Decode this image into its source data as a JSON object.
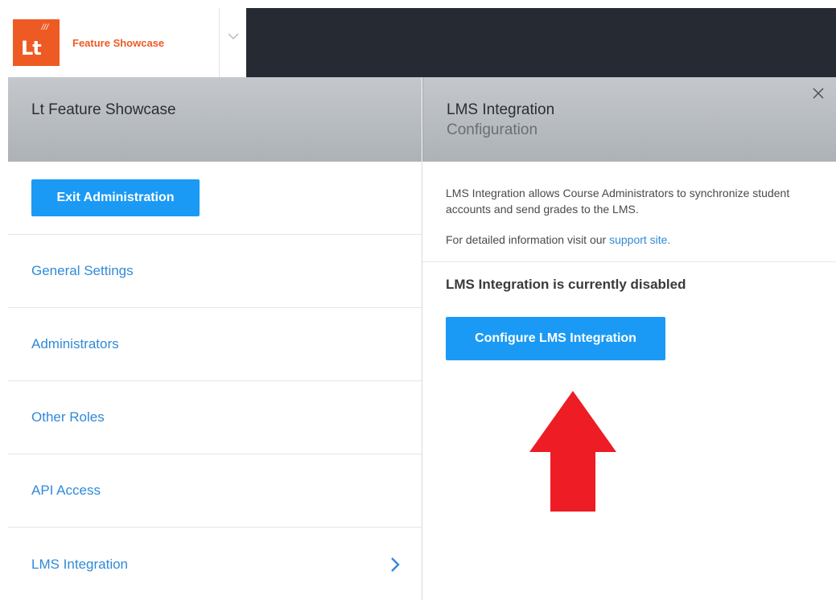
{
  "brand": {
    "logo_text": "Lt",
    "logo_mark": "///",
    "name": "Feature Showcase",
    "logo_color": "#ee5a24"
  },
  "left": {
    "title": "Lt Feature Showcase",
    "exit_label": "Exit Administration",
    "nav": [
      {
        "label": "General Settings"
      },
      {
        "label": "Administrators"
      },
      {
        "label": "Other Roles"
      },
      {
        "label": "API Access"
      },
      {
        "label": "LMS Integration"
      }
    ]
  },
  "right": {
    "title": "LMS Integration",
    "subtitle": "Configuration",
    "description": "LMS Integration allows Course Administrators to synchronize student accounts and send grades to the LMS.",
    "info_prefix": "For detailed information visit our",
    "info_link": "support site.",
    "status": "LMS Integration is currently disabled",
    "configure_label": "Configure LMS Integration"
  },
  "colors": {
    "accent": "#1b9af5",
    "link": "#2f8ad8",
    "topbar": "#262a33",
    "annotation_arrow": "#ee1c25"
  },
  "icons": {
    "switcher": "chevron-down-icon",
    "close": "close-icon",
    "nav_active": "chevron-right-icon",
    "annotation": "arrow-up-icon"
  }
}
